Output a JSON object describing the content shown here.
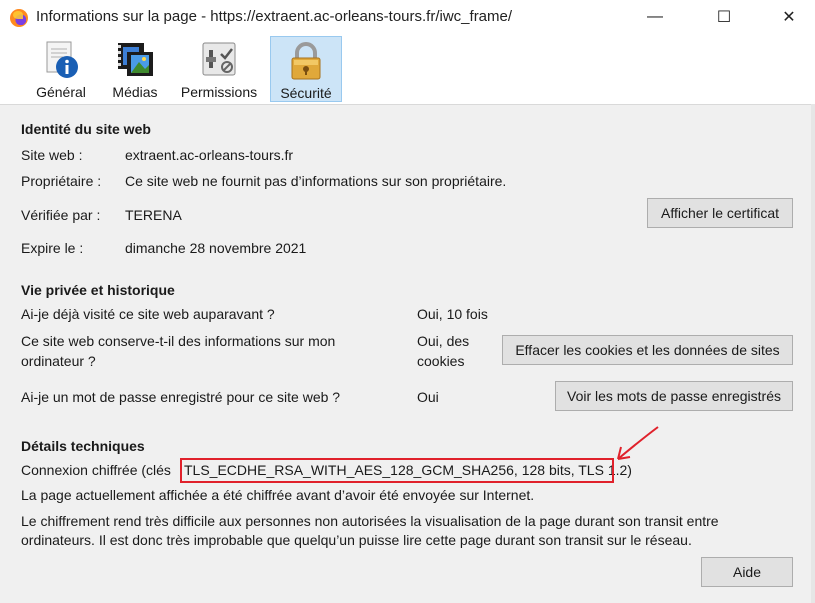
{
  "window": {
    "title": "Informations sur la page - https://extraent.ac-orleans-tours.fr/iwc_frame/",
    "minimize": "—",
    "maximize": "☐",
    "close": "✕"
  },
  "tabs": [
    {
      "label": "Général",
      "icon": "info-icon",
      "selected": false
    },
    {
      "label": "Médias",
      "icon": "media-icon",
      "selected": false
    },
    {
      "label": "Permissions",
      "icon": "permissions-icon",
      "selected": false
    },
    {
      "label": "Sécurité",
      "icon": "lock-icon",
      "selected": true
    }
  ],
  "identity": {
    "heading": "Identité du site web",
    "site_label": "Site web :",
    "site_value": "extraent.ac-orleans-tours.fr",
    "owner_label": "Propriétaire :",
    "owner_value": "Ce site web ne fournit pas d’informations sur son propriétaire.",
    "verified_label": "Vérifiée par :",
    "verified_value": "TERENA",
    "expires_label": "Expire le :",
    "expires_value": "dimanche 28 novembre 2021",
    "cert_button": "Afficher le certificat"
  },
  "privacy": {
    "heading": "Vie privée et historique",
    "q1": "Ai-je déjà visité ce site web auparavant ?",
    "a1": "Oui, 10 fois",
    "q2_line1": "Ce site web conserve-t-il des informations sur mon",
    "q2_line2": "ordinateur ?",
    "a2_line1": "Oui, des",
    "a2_line2": "cookies",
    "clear_button": "Effacer les cookies et les données de sites",
    "q3": "Ai-je un mot de passe enregistré pour ce site web ?",
    "a3": "Oui",
    "passwords_button": "Voir les mots de passe enregistrés"
  },
  "technical": {
    "heading": "Détails techniques",
    "connection_prefix": "Connexion chiffrée (clés",
    "connection_details": "TLS_ECDHE_RSA_WITH_AES_128_GCM_SHA256, 128 bits, TLS 1.2)",
    "line2": "La page actuellement affichée a été chiffrée avant d’avoir été envoyée sur Internet.",
    "line3": "Le chiffrement rend très difficile aux personnes non autorisées la visualisation de la page durant son transit entre",
    "line4": "ordinateurs. Il est donc très improbable que quelqu’un puisse lire cette page durant son transit sur le réseau."
  },
  "help_button": "Aide",
  "colors": {
    "annotation": "#e0212b",
    "selected_tab": "#cce4f7"
  }
}
